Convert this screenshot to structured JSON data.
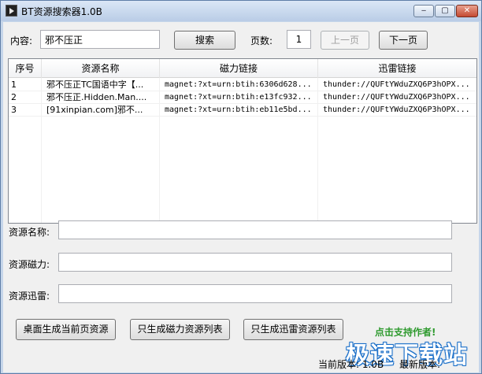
{
  "window": {
    "title": "BT资源搜索器1.0B",
    "min_symbol": "‒",
    "max_symbol": "▢",
    "close_symbol": "✕"
  },
  "search": {
    "content_label": "内容:",
    "content_value": "邪不压正",
    "search_button": "搜索",
    "page_label": "页数:",
    "page_value": "1",
    "prev_button": "上一页",
    "next_button": "下一页"
  },
  "table": {
    "columns": [
      "序号",
      "资源名称",
      "磁力链接",
      "迅雷链接"
    ],
    "rows": [
      {
        "index": "1",
        "name": "邪不压正TC国语中字【...",
        "magnet": "magnet:?xt=urn:btih:6306d628...",
        "thunder": "thunder://QUFtYWduZXQ6P3hOPX..."
      },
      {
        "index": "2",
        "name": "邪不压正.Hidden.Man....",
        "magnet": "magnet:?xt=urn:btih:e13fc932...",
        "thunder": "thunder://QUFtYWduZXQ6P3hOPX..."
      },
      {
        "index": "3",
        "name": "[91xinpian.com]邪不...",
        "magnet": "magnet:?xt=urn:btih:eb11e5bd...",
        "thunder": "thunder://QUFtYWduZXQ6P3hOPX..."
      }
    ]
  },
  "details": {
    "name_label": "资源名称:",
    "name_value": "",
    "magnet_label": "资源磁力:",
    "magnet_value": "",
    "thunder_label": "资源迅雷:",
    "thunder_value": ""
  },
  "actions": {
    "desktop_button": "桌面生成当前页资源",
    "magnet_list_button": "只生成磁力资源列表",
    "thunder_list_button": "只生成迅雷资源列表",
    "support_link": "点击支持作者!"
  },
  "status": {
    "current_version": "当前版本: 1.0B",
    "latest_version": "最新版本:"
  },
  "watermark": "极速下载站",
  "colors": {
    "titlebar": "#c6d6ea",
    "support_link": "#2e9a2e",
    "watermark_outline": "#1a6fc9"
  }
}
